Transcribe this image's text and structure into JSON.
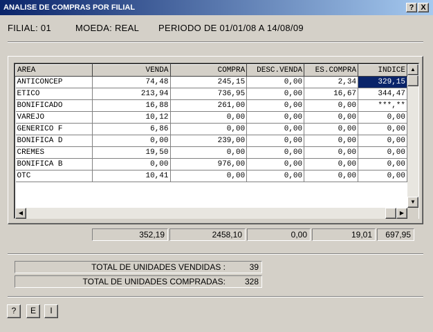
{
  "window": {
    "title": "ANALISE DE COMPRAS POR FILIAL",
    "help_btn": "?",
    "close_btn": "X"
  },
  "header": {
    "filial": "FILIAL: 01",
    "moeda": "MOEDA: REAL",
    "periodo": "PERIODO DE 01/01/08 A 14/08/09"
  },
  "grid": {
    "columns": [
      "AREA",
      "VENDA",
      "COMPRA",
      "DESC.VENDA",
      "ES.COMPRA",
      "INDICE"
    ],
    "rows": [
      [
        "ANTICONCEP",
        "74,48",
        "245,15",
        "0,00",
        "2,34",
        "329,15"
      ],
      [
        "ETICO",
        "213,94",
        "736,95",
        "0,00",
        "16,67",
        "344,47"
      ],
      [
        "BONIFICADO",
        "16,88",
        "261,00",
        "0,00",
        "0,00",
        "***,**"
      ],
      [
        "VAREJO",
        "10,12",
        "0,00",
        "0,00",
        "0,00",
        "0,00"
      ],
      [
        "GENERICO F",
        "6,86",
        "0,00",
        "0,00",
        "0,00",
        "0,00"
      ],
      [
        "BONIFICA D",
        "0,00",
        "239,00",
        "0,00",
        "0,00",
        "0,00"
      ],
      [
        "CREMES",
        "19,50",
        "0,00",
        "0,00",
        "0,00",
        "0,00"
      ],
      [
        "BONIFICA B",
        "0,00",
        "976,00",
        "0,00",
        "0,00",
        "0,00"
      ],
      [
        "OTC",
        "10,41",
        "0,00",
        "0,00",
        "0,00",
        "0,00"
      ]
    ],
    "selected_cell": "329,15"
  },
  "totals": {
    "venda": "352,19",
    "compra": "2458,10",
    "desc_venda": "0,00",
    "es_compra": "19,01",
    "indice": "697,95"
  },
  "units": {
    "vendidas_label": "TOTAL DE UNIDADES VENDIDAS :",
    "vendidas_value": "39",
    "compradas_label": "TOTAL DE UNIDADES COMPRADAS:",
    "compradas_value": "328"
  },
  "buttons": {
    "help": "?",
    "e": "E",
    "i": "I"
  }
}
